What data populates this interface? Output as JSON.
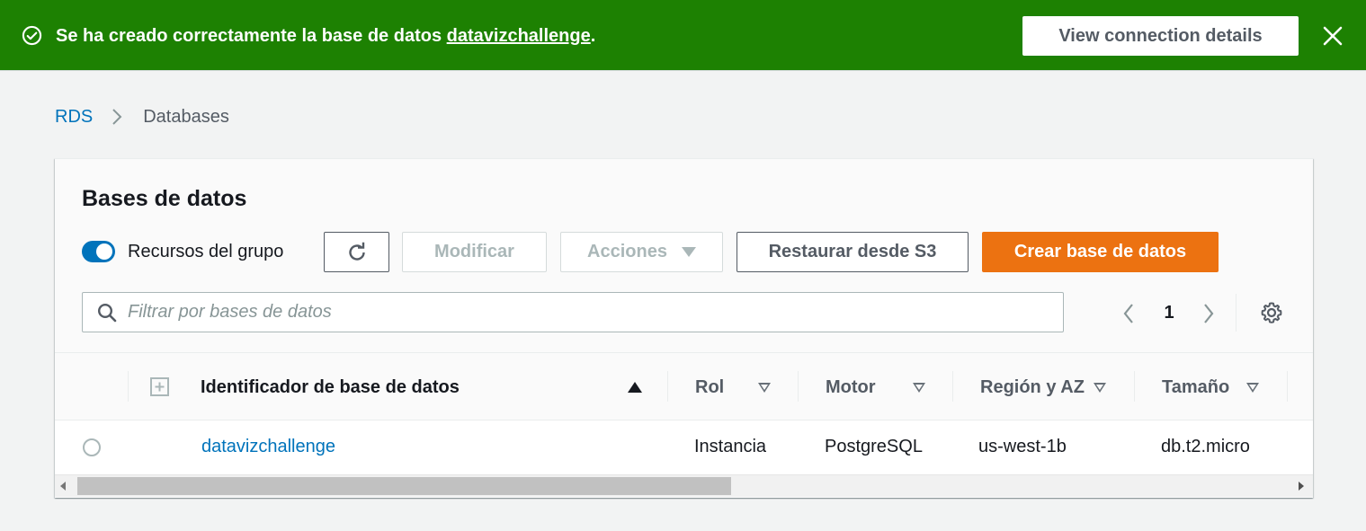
{
  "flash": {
    "type": "success",
    "message_prefix": "Se ha creado correctamente la base de datos ",
    "db_link": "datavizchallenge",
    "message_suffix": ".",
    "action_label": "View connection details",
    "icon": "check-circle-icon",
    "close_icon": "close-icon"
  },
  "breadcrumb": {
    "items": [
      {
        "label": "RDS",
        "link": true
      },
      {
        "label": "Databases",
        "link": false
      }
    ]
  },
  "panel": {
    "title": "Bases de datos",
    "group_toggle": {
      "label": "Recursos del grupo",
      "on": true
    },
    "toolbar": {
      "refresh_icon": "refresh-icon",
      "modify_label": "Modificar",
      "actions_label": "Acciones",
      "restore_label": "Restaurar desde S3",
      "create_label": "Crear base de datos"
    },
    "search": {
      "placeholder": "Filtrar por bases de datos",
      "value": ""
    },
    "pagination": {
      "current_page": "1"
    }
  },
  "table": {
    "columns": [
      {
        "label": "Identificador de base de datos",
        "sort": "ascending"
      },
      {
        "label": "Rol",
        "sort": "none"
      },
      {
        "label": "Motor",
        "sort": "none"
      },
      {
        "label": "Región y AZ",
        "sort": "none"
      },
      {
        "label": "Tamaño",
        "sort": "none"
      }
    ],
    "rows": [
      {
        "identifier": "datavizchallenge",
        "role": "Instancia",
        "engine": "PostgreSQL",
        "region_az": "us-west-1b",
        "size": "db.t2.micro"
      }
    ]
  },
  "colors": {
    "success_green": "#1d8102",
    "link_blue": "#0073bb",
    "primary_orange": "#ec7211"
  }
}
